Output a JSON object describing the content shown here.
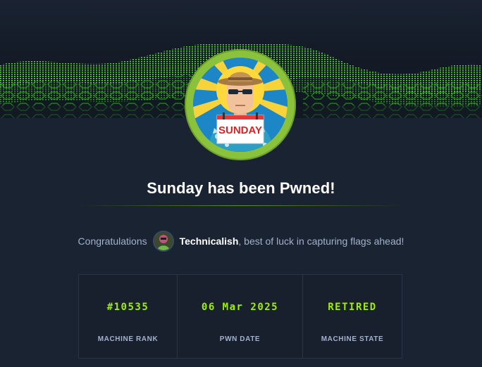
{
  "machine": {
    "name_on_badge": "SUNDAY",
    "pwned_title": "Sunday has been Pwned!"
  },
  "congrats": {
    "prefix": "Congratulations",
    "username": "Technicalish",
    "suffix": ", best of luck in capturing flags ahead!"
  },
  "stats": [
    {
      "value": "#10535",
      "label": "MACHINE RANK"
    },
    {
      "value": "06 Mar 2025",
      "label": "PWN DATE"
    },
    {
      "value": "RETIRED",
      "label": "MACHINE STATE"
    }
  ],
  "colors": {
    "accent": "#9fef00",
    "background": "#1a2332",
    "ring": "#8ac33b"
  },
  "icons": {
    "machine_avatar": "sunday-machine-avatar",
    "user_avatar": "user-avatar"
  }
}
